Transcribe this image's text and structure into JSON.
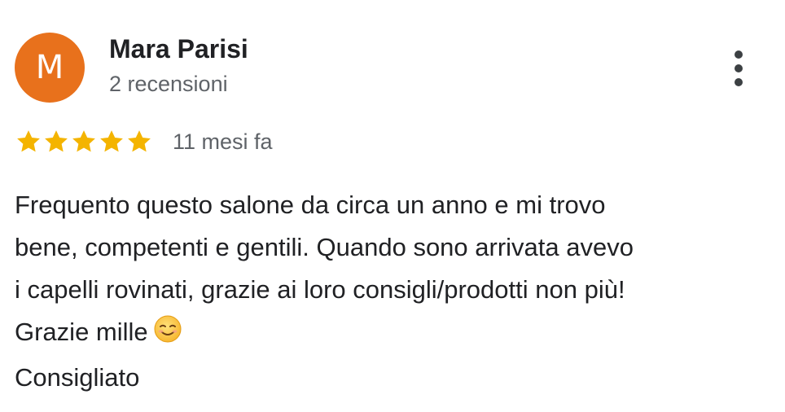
{
  "reviewer": {
    "avatar_initial": "M",
    "avatar_color": "#e8711c",
    "name": "Mara Parisi",
    "review_count": "2 recensioni"
  },
  "menu": {
    "icon": "more-vert-icon"
  },
  "review": {
    "rating": 5,
    "max_rating": 5,
    "star_color": "#f4b400",
    "time": "11 mesi fa",
    "text_lines": [
      "Frequento questo salone da circa un anno e mi trovo",
      "bene, competenti e gentili. Quando sono arrivata avevo",
      "i capelli rovinati, grazie ai loro consigli/prodotti non più!",
      "Grazie mille",
      "Consigliato"
    ],
    "emoji": "smiling-face-icon"
  }
}
